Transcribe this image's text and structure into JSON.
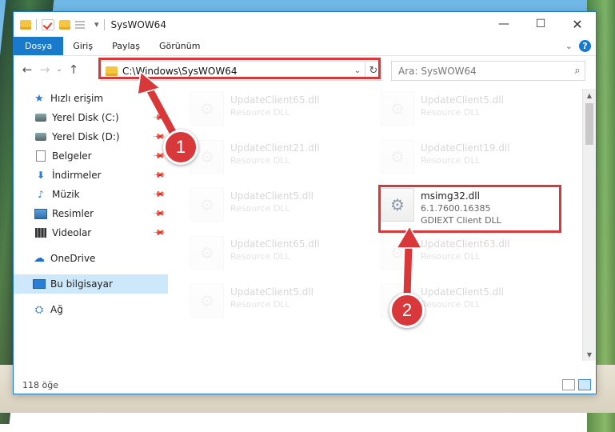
{
  "window": {
    "title": "SysWOW64",
    "controls": {
      "minimize": "—",
      "maximize": "☐",
      "close": "✕"
    }
  },
  "ribbon": {
    "tabs": [
      {
        "label": "Dosya",
        "active": true
      },
      {
        "label": "Giriş",
        "active": false
      },
      {
        "label": "Paylaş",
        "active": false
      },
      {
        "label": "Görünüm",
        "active": false
      }
    ]
  },
  "nav": {
    "back": "←",
    "forward": "→",
    "recent": "⌄",
    "up": "↑",
    "address": "C:\\Windows\\SysWOW64",
    "search_placeholder": "Ara: SysWOW64"
  },
  "sidebar": {
    "quick_access": "Hızlı erişim",
    "items": [
      {
        "label": "Yerel Disk (C:)",
        "icon": "disk-icon",
        "pinned": true
      },
      {
        "label": "Yerel Disk (D:)",
        "icon": "disk-icon",
        "pinned": true
      },
      {
        "label": "Belgeler",
        "icon": "document-icon",
        "pinned": true
      },
      {
        "label": "İndirmeler",
        "icon": "download-icon",
        "pinned": true
      },
      {
        "label": "Müzik",
        "icon": "music-icon",
        "pinned": true
      },
      {
        "label": "Resimler",
        "icon": "pictures-icon",
        "pinned": true
      },
      {
        "label": "Videolar",
        "icon": "video-icon",
        "pinned": true
      }
    ],
    "onedrive": "OneDrive",
    "this_pc": "Bu bilgisayar",
    "network": "Ağ"
  },
  "files": [
    {
      "name": "UpdateClient65.dll",
      "desc": "Resource DLL"
    },
    {
      "name": "UpdateClient5.dll",
      "desc": "Resource DLL"
    },
    {
      "name": "UpdateClient21.dll",
      "desc": "Resource DLL"
    },
    {
      "name": "UpdateClient19.dll",
      "desc": "Resource DLL"
    },
    {
      "name": "UpdateClient5.dll",
      "desc": "Resource DLL"
    },
    {
      "name": "msimg32.dll",
      "desc": "6.1.7600.16385",
      "desc2": "GDIEXT Client DLL"
    },
    {
      "name": "UpdateClient65.dll",
      "desc": "Resource DLL"
    },
    {
      "name": "UpdateClient63.dll",
      "desc": "Resource DLL"
    },
    {
      "name": "UpdateClient5.dll",
      "desc": "Resource DLL"
    },
    {
      "name": "UpdateClient5.dll",
      "desc": "Resource DLL"
    }
  ],
  "status": {
    "item_count": "118 öğe"
  },
  "annotations": {
    "step1": "1",
    "step2": "2",
    "color": "#d8383a"
  }
}
